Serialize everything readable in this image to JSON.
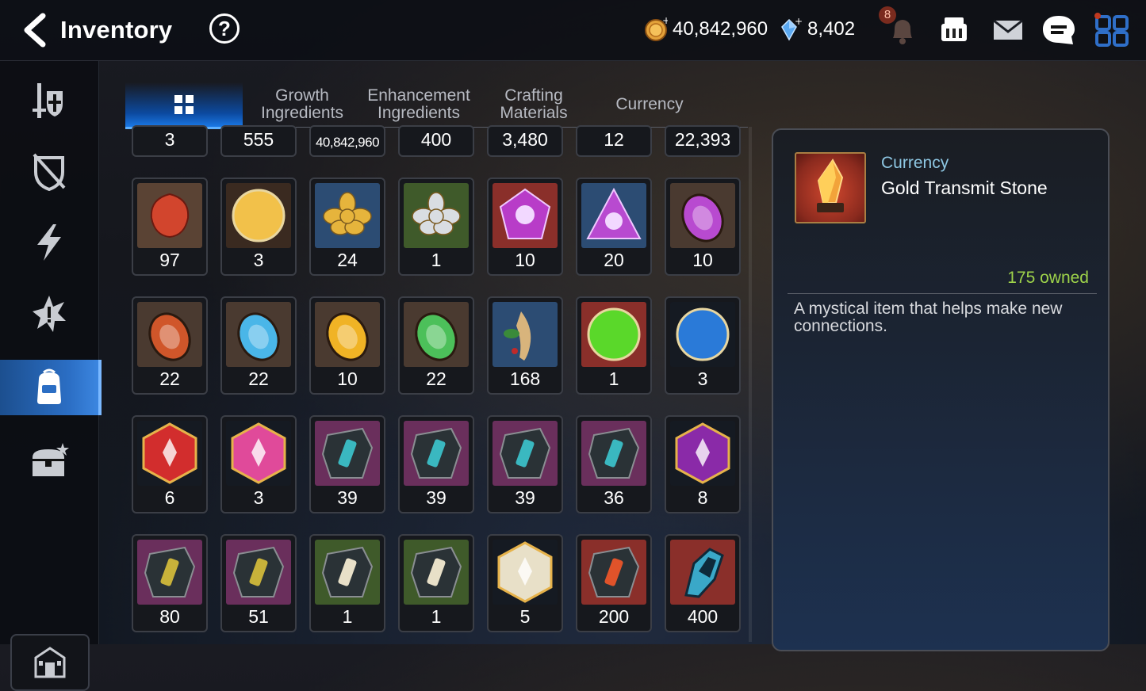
{
  "header": {
    "title": "Inventory",
    "help_label": "?",
    "gold": "40,842,960",
    "crystals": "8,402",
    "notification_count": "8",
    "icons": [
      "back-arrow-icon",
      "help-icon",
      "gold-coin-icon",
      "crystal-icon",
      "bell-icon",
      "shop-icon",
      "mail-icon",
      "chat-icon",
      "menu-grid-icon"
    ]
  },
  "sidebar": {
    "items": [
      {
        "name": "equipment",
        "icon": "sword-shield-icon"
      },
      {
        "name": "artifact",
        "icon": "broken-shield-icon"
      },
      {
        "name": "skill",
        "icon": "lightning-icon"
      },
      {
        "name": "special",
        "icon": "burst-icon"
      },
      {
        "name": "items",
        "icon": "backpack-icon",
        "active": true
      },
      {
        "name": "chest",
        "icon": "treasure-chest-icon"
      }
    ],
    "bottom_icon": "town-icon"
  },
  "tabs": [
    {
      "label": "",
      "icon": "grid-icon",
      "active": true
    },
    {
      "label": "Growth\nIngredients"
    },
    {
      "label": "Enhancement\nIngredients"
    },
    {
      "label": "Crafting\nMaterials"
    },
    {
      "label": "Currency"
    }
  ],
  "grid": {
    "top_row": [
      "3",
      "555",
      "40,842,960",
      "400",
      "3,480",
      "12",
      "22,393"
    ],
    "rows": [
      [
        {
          "q": "97",
          "kind": "flame-leaf"
        },
        {
          "q": "3",
          "kind": "mascot-coin"
        },
        {
          "q": "24",
          "kind": "gold-flower"
        },
        {
          "q": "1",
          "kind": "silver-flower"
        },
        {
          "q": "10",
          "kind": "purple-moon-gem-large"
        },
        {
          "q": "20",
          "kind": "purple-moon-gem"
        },
        {
          "q": "10",
          "kind": "purple-moon-stone"
        }
      ],
      [
        {
          "q": "22",
          "kind": "fire-rune"
        },
        {
          "q": "22",
          "kind": "ice-rune"
        },
        {
          "q": "10",
          "kind": "light-rune"
        },
        {
          "q": "22",
          "kind": "earth-rune"
        },
        {
          "q": "168",
          "kind": "ginseng-root"
        },
        {
          "q": "1",
          "kind": "green-orb"
        },
        {
          "q": "3",
          "kind": "blue-circuit-coin"
        }
      ],
      [
        {
          "q": "6",
          "kind": "red-hex-gem"
        },
        {
          "q": "3",
          "kind": "pink-potion"
        },
        {
          "q": "39",
          "kind": "sword-rune"
        },
        {
          "q": "39",
          "kind": "helm-rune"
        },
        {
          "q": "39",
          "kind": "armor-rune"
        },
        {
          "q": "36",
          "kind": "boot-rune"
        },
        {
          "q": "8",
          "kind": "purple-hex-rune"
        }
      ],
      [
        {
          "q": "80",
          "kind": "hammer-rune"
        },
        {
          "q": "51",
          "kind": "bolt-rune"
        },
        {
          "q": "1",
          "kind": "white-sword-rune"
        },
        {
          "q": "1",
          "kind": "white-helm-rune"
        },
        {
          "q": "5",
          "kind": "white-hex-rune"
        },
        {
          "q": "200",
          "kind": "magma-stone"
        },
        {
          "q": "400",
          "kind": "crystal-shard"
        }
      ]
    ]
  },
  "detail": {
    "category": "Currency",
    "name": "Gold Transmit Stone",
    "owned": "175 owned",
    "description": "A mystical item that helps make new connections.",
    "icon": "gold-transmit-stone-icon"
  },
  "colors": {
    "accent_blue": "#2b6ec4",
    "owned_green": "#9ed34a",
    "category_cyan": "#8ec7e3",
    "gold": "#e3a23a",
    "frame_gold": "#a97e43"
  }
}
